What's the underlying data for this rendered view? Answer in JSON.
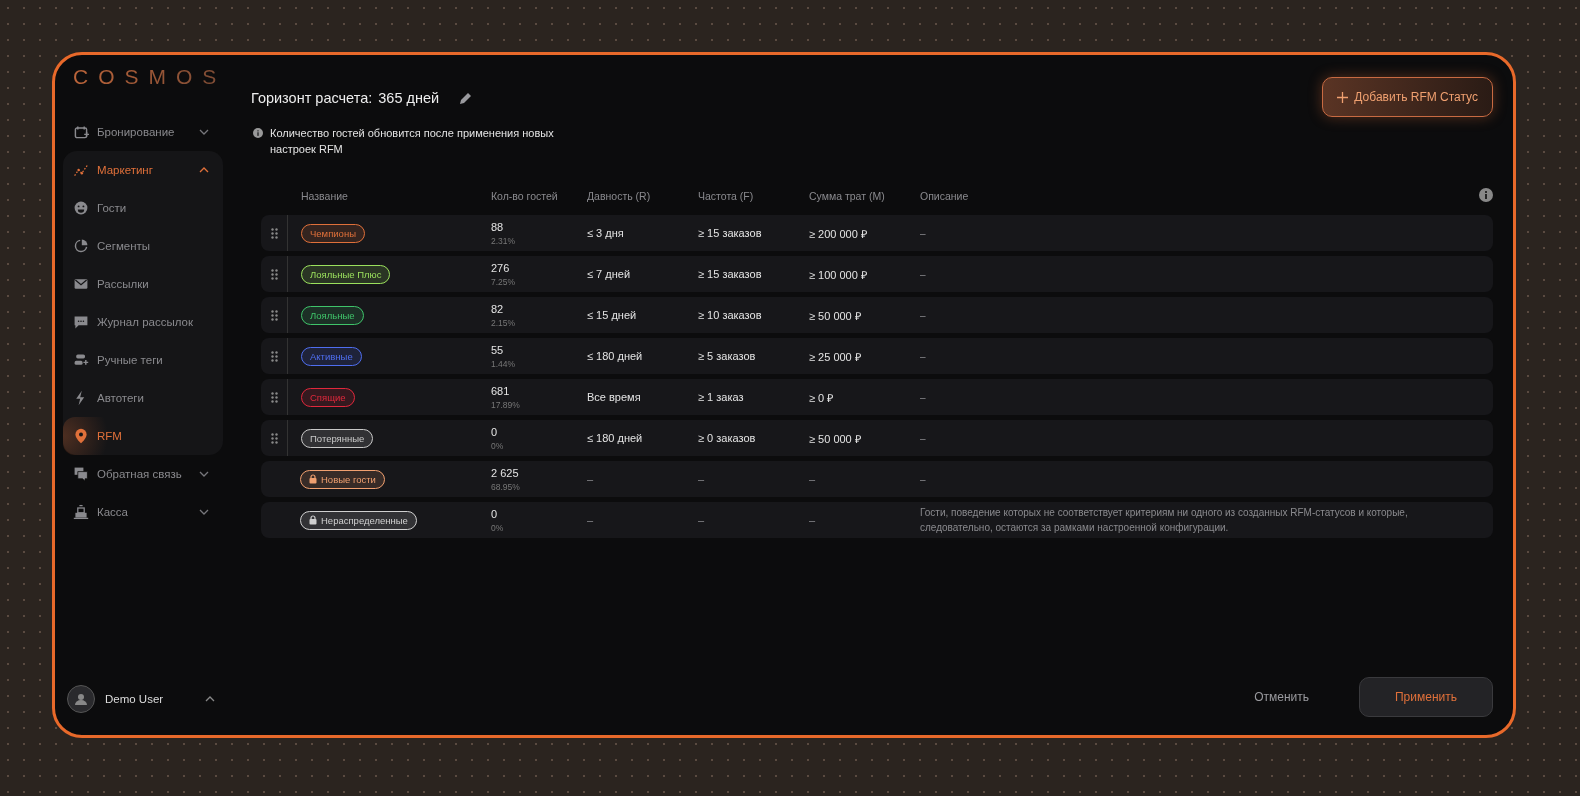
{
  "logo": "COSMOS",
  "sidebar": {
    "items": [
      {
        "label": "Бронирование",
        "kind": "group",
        "expanded": false,
        "selected": false
      },
      {
        "label": "Маркетинг",
        "kind": "group",
        "expanded": true,
        "selected": true,
        "children": [
          {
            "label": "Гости",
            "selected": false
          },
          {
            "label": "Сегменты",
            "selected": false
          },
          {
            "label": "Рассылки",
            "selected": false
          },
          {
            "label": "Журнал рассылок",
            "selected": false
          },
          {
            "label": "Ручные теги",
            "selected": false
          },
          {
            "label": "Автотеги",
            "selected": false
          },
          {
            "label": "RFM",
            "selected": true
          }
        ]
      },
      {
        "label": "Обратная связь",
        "kind": "group",
        "expanded": false,
        "selected": false
      },
      {
        "label": "Касса",
        "kind": "group",
        "expanded": false,
        "selected": false
      }
    ],
    "user": {
      "name": "Demo User",
      "expanded": true
    }
  },
  "header": {
    "title": "Горизонт расчета:",
    "value": "365 дней",
    "note": "Количество гостей обновится после применения новых настроек RFM",
    "add_button": "Добавить RFM Статус"
  },
  "table": {
    "columns": [
      "Название",
      "Кол-во гостей",
      "Давность  (R)",
      "Частота  (F)",
      "Сумма трат  (M)",
      "Описание"
    ],
    "rows": [
      {
        "name": "Чемпионы",
        "color": "#e0703a",
        "locked": false,
        "draggable": true,
        "count": "88",
        "share": "2.31%",
        "recency": "≤ 3 дня",
        "frequency": "≥ 15 заказов",
        "monetary": "≥ 200 000 ₽",
        "description": "–"
      },
      {
        "name": "Лояльные Плюс",
        "color": "#9be15d",
        "locked": false,
        "draggable": true,
        "count": "276",
        "share": "7.25%",
        "recency": "≤ 7 дней",
        "frequency": "≥ 15 заказов",
        "monetary": "≥ 100 000 ₽",
        "description": "–"
      },
      {
        "name": "Лояльные",
        "color": "#3fc46a",
        "locked": false,
        "draggable": true,
        "count": "82",
        "share": "2.15%",
        "recency": "≤ 15 дней",
        "frequency": "≥ 10 заказов",
        "monetary": "≥ 50 000 ₽",
        "description": "–"
      },
      {
        "name": "Активные",
        "color": "#4f6ef0",
        "locked": false,
        "draggable": true,
        "count": "55",
        "share": "1.44%",
        "recency": "≤ 180 дней",
        "frequency": "≥ 5 заказов",
        "monetary": "≥ 25 000 ₽",
        "description": "–"
      },
      {
        "name": "Спящие",
        "color": "#e0283c",
        "locked": false,
        "draggable": true,
        "count": "681",
        "share": "17.89%",
        "recency": "Все время",
        "frequency": "≥ 1 заказ",
        "monetary": "≥ 0 ₽",
        "description": "–"
      },
      {
        "name": "Потерянные",
        "color": "#c8c8c8",
        "locked": false,
        "draggable": true,
        "count": "0",
        "share": "0%",
        "recency": "≤ 180 дней",
        "frequency": "≥ 0 заказов",
        "monetary": "≥ 50 000 ₽",
        "description": "–"
      },
      {
        "name": "Новые гости",
        "color": "#f0a070",
        "locked": true,
        "draggable": false,
        "count": "2 625",
        "share": "68.95%",
        "recency": "–",
        "frequency": "–",
        "monetary": "–",
        "description": "–"
      },
      {
        "name": "Нераспределенные",
        "color": "#d0d0d0",
        "locked": true,
        "draggable": false,
        "count": "0",
        "share": "0%",
        "recency": "–",
        "frequency": "–",
        "monetary": "–",
        "description": "Гости, поведение которых не соответствует критериям ни одного из созданных RFM-статусов и которые, следовательно, остаются за рамками настроенной конфигурации."
      }
    ]
  },
  "footer": {
    "cancel": "Отменить",
    "apply": "Применить"
  }
}
